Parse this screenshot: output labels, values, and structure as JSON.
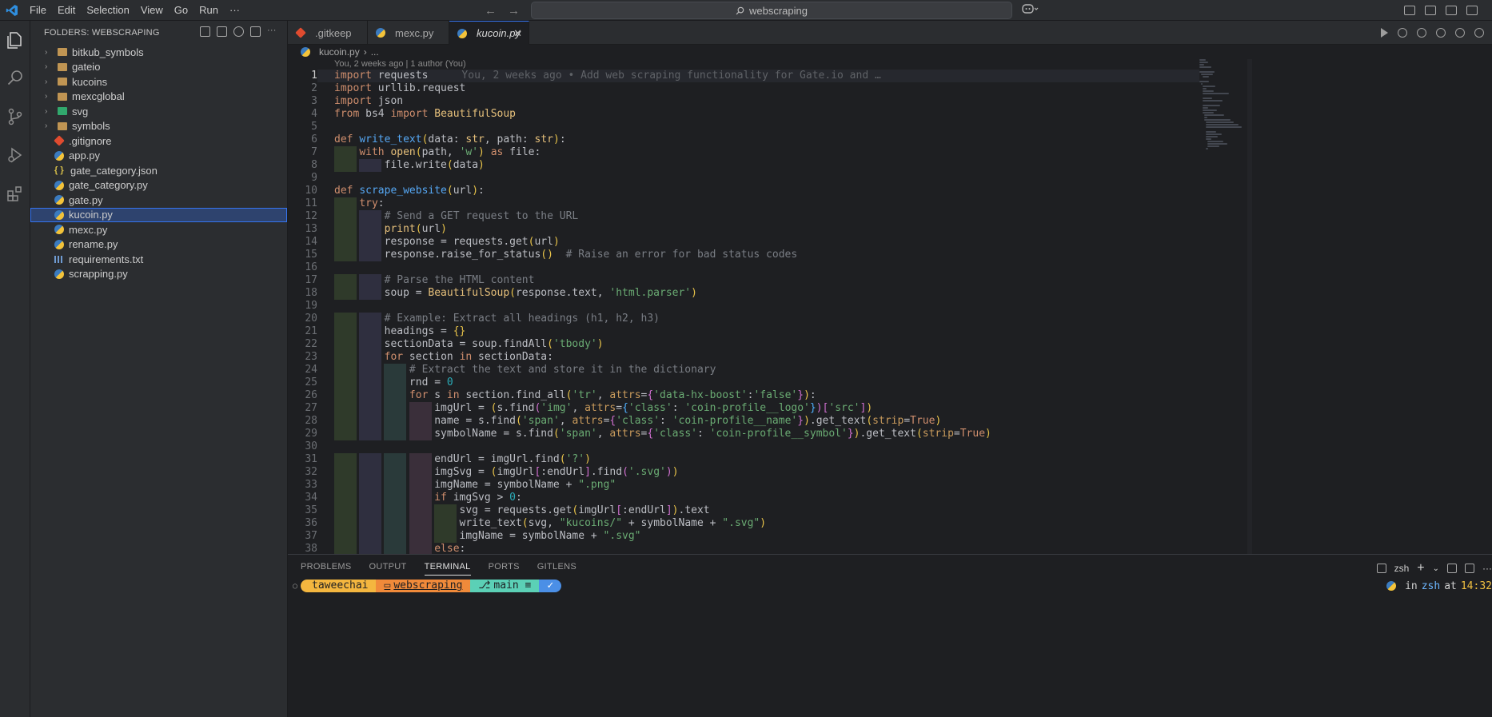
{
  "menu": [
    "File",
    "Edit",
    "Selection",
    "View",
    "Go",
    "Run",
    "···"
  ],
  "search": {
    "text": "webscraping"
  },
  "sidebar": {
    "title": "FOLDERS: WEBSCRAPING",
    "items": [
      {
        "label": "bitkub_symbols",
        "kind": "folder"
      },
      {
        "label": "gateio",
        "kind": "folder"
      },
      {
        "label": "kucoins",
        "kind": "folder"
      },
      {
        "label": "mexcglobal",
        "kind": "folder"
      },
      {
        "label": "svg",
        "kind": "svgfolder"
      },
      {
        "label": "symbols",
        "kind": "folder"
      },
      {
        "label": ".gitignore",
        "kind": "git"
      },
      {
        "label": "app.py",
        "kind": "py"
      },
      {
        "label": "gate_category.json",
        "kind": "json"
      },
      {
        "label": "gate_category.py",
        "kind": "py"
      },
      {
        "label": "gate.py",
        "kind": "py"
      },
      {
        "label": "kucoin.py",
        "kind": "py",
        "selected": true
      },
      {
        "label": "mexc.py",
        "kind": "py"
      },
      {
        "label": "rename.py",
        "kind": "py"
      },
      {
        "label": "requirements.txt",
        "kind": "txt"
      },
      {
        "label": "scrapping.py",
        "kind": "py"
      }
    ]
  },
  "tabs": [
    {
      "label": ".gitkeep",
      "icon": "git"
    },
    {
      "label": "mexc.py",
      "icon": "py"
    },
    {
      "label": "kucoin.py",
      "icon": "py",
      "active": true
    }
  ],
  "breadcrumbs": {
    "file": "kucoin.py",
    "sep": "›",
    "rest": "..."
  },
  "blame": "You, 2 weeks ago | 1 author (You)",
  "ghost_blame": "You, 2 weeks ago • Add web scraping functionality for Gate.io and …",
  "code_lines": [
    "import requests",
    "import urllib.request",
    "import json",
    "from bs4 import BeautifulSoup",
    "",
    "def write_text(data: str, path: str):",
    "    with open(path, 'w') as file:",
    "        file.write(data)",
    "",
    "def scrape_website(url):",
    "    try:",
    "        # Send a GET request to the URL",
    "        print(url)",
    "        response = requests.get(url)",
    "        response.raise_for_status()  # Raise an error for bad status codes",
    "",
    "        # Parse the HTML content",
    "        soup = BeautifulSoup(response.text, 'html.parser')",
    "",
    "        # Example: Extract all headings (h1, h2, h3)",
    "        headings = {}",
    "        sectionData = soup.findAll('tbody')",
    "        for section in sectionData:",
    "            # Extract the text and store it in the dictionary",
    "            rnd = 0",
    "            for s in section.find_all('tr', attrs={'data-hx-boost':'false'}):",
    "                imgUrl = (s.find('img', attrs={'class': 'coin-profile__logo'})['src'])",
    "                name = s.find('span', attrs={'class': 'coin-profile__name'}).get_text(strip=True)",
    "                symbolName = s.find('span', attrs={'class': 'coin-profile__symbol'}).get_text(strip=True)",
    "",
    "                endUrl = imgUrl.find('?')",
    "                imgSvg = (imgUrl[:endUrl].find('.svg'))",
    "                imgName = symbolName + \".png\"",
    "                if imgSvg > 0:",
    "                    svg = requests.get(imgUrl[:endUrl]).text",
    "                    write_text(svg, \"kucoins/\" + symbolName + \".svg\")",
    "                    imgName = symbolName + \".svg\"",
    "                else:"
  ],
  "panel": {
    "tabs": [
      "PROBLEMS",
      "OUTPUT",
      "TERMINAL",
      "PORTS",
      "GITLENS"
    ],
    "active_tab": "TERMINAL",
    "shell_label": "zsh"
  },
  "terminal": {
    "user": "taweechai",
    "dir": "webscraping",
    "branch": "main ≡",
    "ok": "✓",
    "right_in": "in",
    "right_shell": "zsh",
    "right_at": "at",
    "right_time": "14:32"
  },
  "colors": {
    "accent": "#3574f0",
    "editor_bg": "#1e1f22",
    "sidebar_bg": "#2b2d30"
  }
}
